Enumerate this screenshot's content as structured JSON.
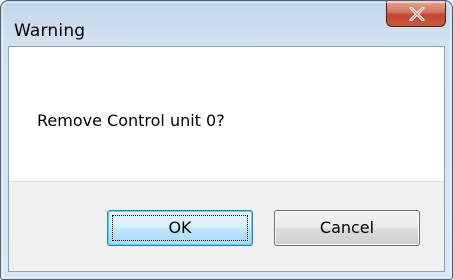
{
  "window": {
    "title": "Warning"
  },
  "titlebar": {
    "close_icon": "close-icon"
  },
  "dialog": {
    "message": "Remove Control unit 0?",
    "buttons": {
      "ok_label": "OK",
      "cancel_label": "Cancel"
    }
  },
  "colors": {
    "frame": "#c9dcee",
    "close_button": "#c85a3c",
    "default_button_border": "#3c7fb1",
    "button_area": "#f0f0f0"
  }
}
